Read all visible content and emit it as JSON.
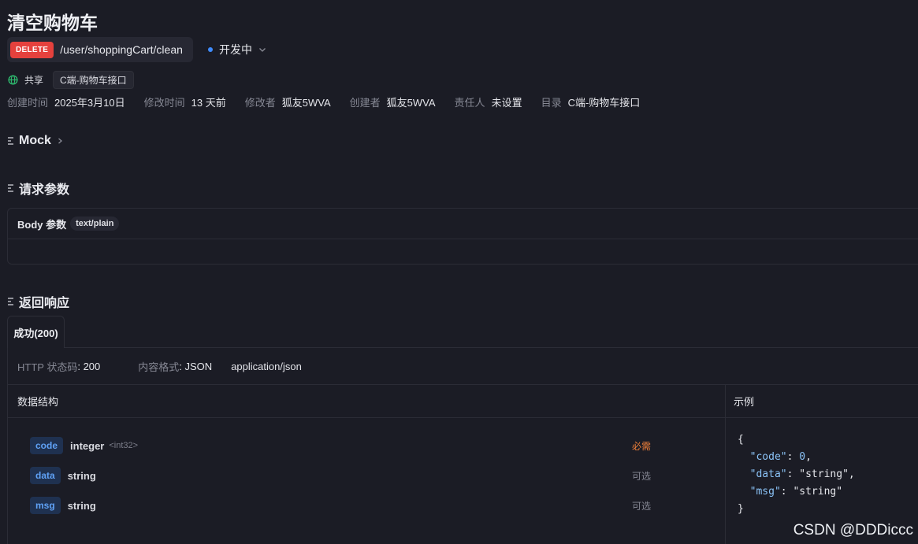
{
  "title": "清空购物车",
  "endpoint": {
    "method": "DELETE",
    "path": "/user/shoppingCart/clean",
    "status": "开发中"
  },
  "share": {
    "label": "共享",
    "folder_tag": "C端-购物车接口"
  },
  "meta": [
    {
      "key": "创建时间",
      "value": "2025年3月10日"
    },
    {
      "key": "修改时间",
      "value": "13 天前"
    },
    {
      "key": "修改者",
      "value": "狐友5WVA"
    },
    {
      "key": "创建者",
      "value": "狐友5WVA"
    },
    {
      "key": "责任人",
      "value": "未设置"
    },
    {
      "key": "目录",
      "value": "C端-购物车接口"
    }
  ],
  "sections": {
    "mock": "Mock",
    "request": "请求参数",
    "response": "返回响应"
  },
  "body_params": {
    "label": "Body 参数",
    "type": "text/plain"
  },
  "response": {
    "tab": "成功(200)",
    "http_key": "HTTP 状态码",
    "http_val": "200",
    "format_key": "内容格式",
    "format_val": "JSON",
    "content_type": "application/json",
    "struct_header": "数据结构",
    "example_header": "示例",
    "fields": [
      {
        "name": "code",
        "type": "integer",
        "format": "<int32>",
        "required": "必需"
      },
      {
        "name": "data",
        "type": "string",
        "format": "",
        "required": "可选"
      },
      {
        "name": "msg",
        "type": "string",
        "format": "",
        "required": "可选"
      }
    ],
    "example": {
      "open": "{",
      "lines": [
        {
          "key": "\"code\"",
          "value": "0",
          "sep": ","
        },
        {
          "key": "\"data\"",
          "value": "\"string\"",
          "sep": ","
        },
        {
          "key": "\"msg\"",
          "value": "\"string\"",
          "sep": ""
        }
      ],
      "close": "}"
    }
  },
  "colors": {
    "required": "#f0803a",
    "optional": "#868894",
    "method_badge": "#e5413d",
    "status_dot": "#3f8cff"
  },
  "watermark": "CSDN @DDDiccc"
}
